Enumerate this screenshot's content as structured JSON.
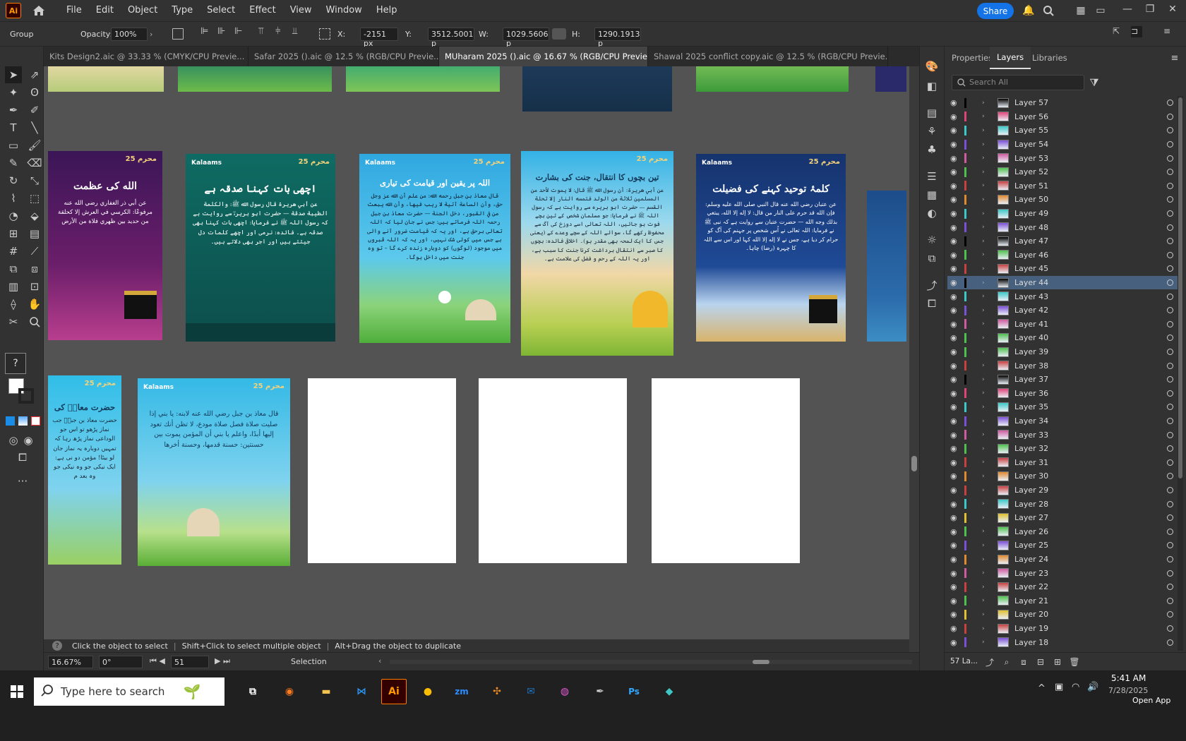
{
  "menubar": {
    "items": [
      "File",
      "Edit",
      "Object",
      "Type",
      "Select",
      "Effect",
      "View",
      "Window",
      "Help"
    ],
    "share_label": "Share",
    "logo": "Ai"
  },
  "controlbar": {
    "selection_label": "Group",
    "opacity_label": "Opacity:",
    "opacity_value": "100%",
    "x_label": "X:",
    "x_value": "-2151 px",
    "y_label": "Y:",
    "y_value": "3512.5001 p",
    "w_label": "W:",
    "w_value": "1029.5606 p",
    "h_label": "H:",
    "h_value": "1290.1913 p"
  },
  "tabs": [
    {
      "label": "Kits Design2.aic @ 33.33 % (CMYK/CPU Previe...",
      "active": false
    },
    {
      "label": "Safar 2025 ().aic @ 12.5 % (RGB/CPU Previe...",
      "active": false
    },
    {
      "label": "MUharam 2025 ().aic @ 16.67 % (RGB/CPU Preview)",
      "active": true
    },
    {
      "label": "Shawal 2025 conflict copy.aic @ 12.5 % (RGB/CPU Previe...",
      "active": false
    }
  ],
  "cards": [
    {
      "title": "الله کی عظمت",
      "body": "عن أبي ذر الغفاري رضي الله عنه مرفوعًا: الكرسي في العرش إلا كحلقة من حديد بين ظهري فلاة من الأرض",
      "brand": "",
      "badge": "محرم 25"
    },
    {
      "title": "اچھی بات کہنا صدقہ ہے",
      "body": "عن أبي هريرة قال رسول الله ﷺ: والكلمة الطيبة صدقة — حضرت ابو ہریرہؓ سے روایت ہے کہ رسول اللہ ﷺ نے فرمایا: اچھی بات کہنا بھی صدقہ ہے۔ فائدہ: نرمی اور اچھے کلمات دل جیتتے ہیں اور اجر بھی دلاتے ہیں۔",
      "brand": "Kalaams",
      "badge": "محرم 25"
    },
    {
      "title": "اللہ پر یقین اور قیامت کی تیاری",
      "body": "قال معاذ بن جبل رحمه الله: من علم أن الله عز وجل حق، وأن الساعة آتية لا ريب فيها، وأن الله يبعث من في القبور، دخل الجنة — حضرت معاذ بن جبل رحمہ اللہ فرماتے ہیں: جس نے جان لیا کہ اللہ تعالی برحق ہے، اور یہ کہ قیامت ضرور آنے والی ہے جس میں کوئی شک نہیں، اور یہ کہ اللہ قبروں میں موجود (لوگوں) کو دوبارہ زندہ کرے گا – تو وہ جنت میں داخل ہوگا۔",
      "brand": "Kalaams",
      "badge": "محرم 25"
    },
    {
      "title": "تین بچوں کا انتقال، جنت کی بشارت",
      "body": "عن أبي هريرة: أن رسول الله ﷺ قال: لا يموت لأحد من المسلمين ثلاثة من الولد فتمسه النار إلا تحلة القسم — حضرت ابو ہریرہ سے روایت ہے کہ رسول اللہ ﷺ نے فرمایا: جو مسلمان شخص کے تین بچے فوت ہو جائیں، اللہ تعالی اسے دوزخ کی آگ سے محفوظ رکھے گا، سوائے اللہ کے سچے وعدے کے (یعنی جس کا ایک لمحہ بھی مقدر ہو)۔ اخلاقی فائدہ: بچوں کا صبر سے انتقال برداشت کرنا جنت کا سبب ہے، اور یہ اللہ کے رحم و فضل کی علامت ہے۔",
      "brand": "",
      "badge": "محرم 25"
    },
    {
      "title": "کلمۂ توحید کہنے کی فضیلت",
      "body": "عن عتبان رضي الله عنه قال النبي صلى الله عليه وسلم: فإن الله قد حرم على النار من قال: لا إله إلا الله، يبتغي بذلك وجه الله — حضرت عتبان سے روایت ہے کہ نبی ﷺ نے فرمایا: اللہ تعالی نے اُس شخص پر جہنم کی آگ کو حرام کر دیا ہے، جس نے لا إله إلا الله کہا اور اس سے اللہ کا چہرہ (رضا) چاہا۔",
      "brand": "Kalaams",
      "badge": "محرم 25"
    },
    {
      "title": "حضرت معاذؓ کی",
      "body": "حضرت معاذ بن جبلؓ جب نماز پڑھو تو اس جو الوداعی نماز پڑھ رہا کہ تمہیں دوبارہ یہ نماز جان لو بیٹا! مؤمن دو نی ہے: ایک نیکی جو وہ نیکی جو وہ بعد م",
      "brand": "",
      "badge": "محرم 25"
    },
    {
      "title": "",
      "body": "قال معاذ بن جبل رضي الله عنه لابنه: يا بني إذا صليت صلاة فصل صلاة مودع، لا تظن أنك تعود إليها أبدًا، واعلم يا بني أن المؤمن يموت بين حسنتين: حسنة قدمها، وحسنة أخرها",
      "brand": "Kalaams",
      "badge": "محرم 25"
    }
  ],
  "layers_panel": {
    "tabs": [
      "Properties",
      "Layers",
      "Libraries"
    ],
    "active_tab": "Layers",
    "search_placeholder": "Search All",
    "layers": [
      {
        "name": "Layer 57",
        "color": "#000000"
      },
      {
        "name": "Layer 56",
        "color": "#e0437a"
      },
      {
        "name": "Layer 55",
        "color": "#3cc8c8"
      },
      {
        "name": "Layer 54",
        "color": "#7b4fd6"
      },
      {
        "name": "Layer 53",
        "color": "#d05aa0"
      },
      {
        "name": "Layer 52",
        "color": "#4fc04f"
      },
      {
        "name": "Layer 51",
        "color": "#c84040"
      },
      {
        "name": "Layer 50",
        "color": "#e08a30"
      },
      {
        "name": "Layer 49",
        "color": "#3cc8c8"
      },
      {
        "name": "Layer 48",
        "color": "#7b4fd6"
      },
      {
        "name": "Layer 47",
        "color": "#000000"
      },
      {
        "name": "Layer 46",
        "color": "#4fc04f"
      },
      {
        "name": "Layer 45",
        "color": "#c84040"
      },
      {
        "name": "Layer 44",
        "color": "#000000"
      },
      {
        "name": "Layer 43",
        "color": "#3cc8c8"
      },
      {
        "name": "Layer 42",
        "color": "#7b4fd6"
      },
      {
        "name": "Layer 41",
        "color": "#d05aa0"
      },
      {
        "name": "Layer 40",
        "color": "#4fc04f"
      },
      {
        "name": "Layer 39",
        "color": "#4fc04f"
      },
      {
        "name": "Layer 38",
        "color": "#c84040"
      },
      {
        "name": "Layer 37",
        "color": "#000000"
      },
      {
        "name": "Layer 36",
        "color": "#e0437a"
      },
      {
        "name": "Layer 35",
        "color": "#3cc8c8"
      },
      {
        "name": "Layer 34",
        "color": "#7b4fd6"
      },
      {
        "name": "Layer 33",
        "color": "#d05aa0"
      },
      {
        "name": "Layer 32",
        "color": "#4fc04f"
      },
      {
        "name": "Layer 31",
        "color": "#c84040"
      },
      {
        "name": "Layer 30",
        "color": "#e08a30"
      },
      {
        "name": "Layer 29",
        "color": "#c84040"
      },
      {
        "name": "Layer 28",
        "color": "#3cc8c8"
      },
      {
        "name": "Layer 27",
        "color": "#e0c030"
      },
      {
        "name": "Layer 26",
        "color": "#4fc04f"
      },
      {
        "name": "Layer 25",
        "color": "#7b4fd6"
      },
      {
        "name": "Layer 24",
        "color": "#e08a30"
      },
      {
        "name": "Layer 23",
        "color": "#d05aa0"
      },
      {
        "name": "Layer 22",
        "color": "#c84040"
      },
      {
        "name": "Layer 21",
        "color": "#4fc04f"
      },
      {
        "name": "Layer 20",
        "color": "#e0c030"
      },
      {
        "name": "Layer 19",
        "color": "#c84040"
      },
      {
        "name": "Layer 18",
        "color": "#7b4fd6"
      }
    ],
    "selected_layer": "Layer 44",
    "footer_count": "57 La..."
  },
  "hint": {
    "text1": "Click the object to select",
    "text2": "Shift+Click to select multiple object",
    "text3": "Alt+Drag the object to duplicate"
  },
  "status": {
    "zoom": "16.67%",
    "rotation": "0°",
    "artboard": "51",
    "mode": "Selection"
  },
  "taskbar": {
    "search_placeholder": "Type here to search",
    "time": "5:41 AM",
    "date": "7/28/2025",
    "open_app": "Open App"
  }
}
